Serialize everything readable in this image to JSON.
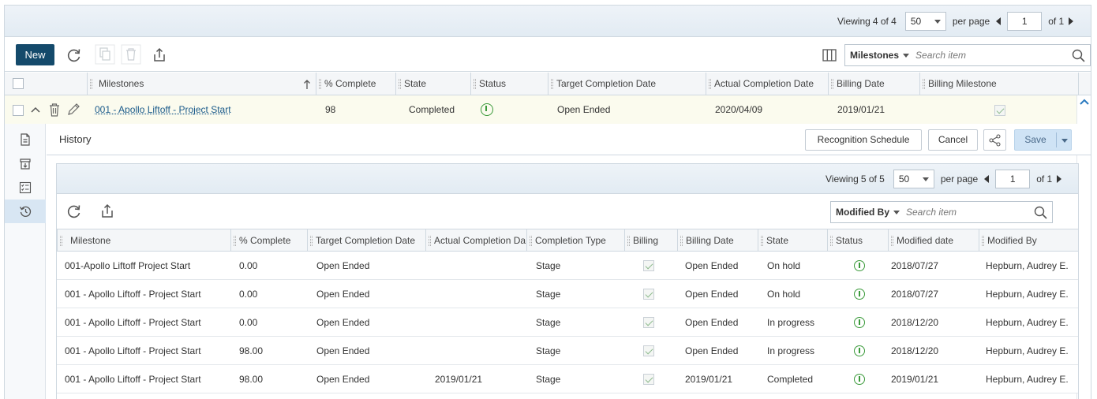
{
  "top_pager": {
    "viewing_label": "Viewing",
    "viewing_range": "4 of 4",
    "per_page_value": "50",
    "per_page_label": "per page",
    "page_value": "1",
    "of_label": "of 1"
  },
  "toolbar": {
    "new_label": "New",
    "search_field": "Milestones",
    "search_placeholder": "Search item"
  },
  "grid": {
    "columns": [
      "Milestones",
      "% Complete",
      "State",
      "Status",
      "Target Completion Date",
      "Actual Completion Date",
      "Billing Date",
      "Billing Milestone"
    ],
    "sorted_column_index": 0,
    "rows": [
      {
        "milestone": "001 - Apollo Liftoff - Project Start",
        "percent_complete": "98",
        "state": "Completed",
        "status": "info",
        "target_completion": "Open Ended",
        "actual_completion": "2020/04/09",
        "billing_date": "2019/01/21",
        "billing_milestone": true
      }
    ]
  },
  "detail": {
    "title": "History",
    "recognition_label": "Recognition Schedule",
    "cancel_label": "Cancel",
    "save_label": "Save",
    "side_nav": [
      "document-icon",
      "archive-icon",
      "checklist-icon",
      "history-icon"
    ],
    "active_side_nav": "history-icon"
  },
  "history_pager": {
    "viewing_label": "Viewing",
    "viewing_range": "5 of 5",
    "per_page_value": "50",
    "per_page_label": "per page",
    "page_value": "1",
    "of_label": "of 1"
  },
  "history_search": {
    "field": "Modified By",
    "placeholder": "Search item"
  },
  "history": {
    "columns": [
      "Milestone",
      "% Complete",
      "Target Completion Date",
      "Actual Completion Da",
      "Completion Type",
      "Billing",
      "Billing Date",
      "State",
      "Status",
      "Modified date",
      "Modified By"
    ],
    "rows": [
      {
        "milestone": "001-Apollo Liftoff Project Start",
        "percent_complete": "0.00",
        "target_completion": "Open Ended",
        "actual_completion": "",
        "completion_type": "Stage",
        "billing": true,
        "billing_date": "Open Ended",
        "state": "On hold",
        "status": "info",
        "modified_date": "2018/07/27",
        "modified_by": "Hepburn, Audrey E."
      },
      {
        "milestone": "001 - Apollo Liftoff - Project Start",
        "percent_complete": "0.00",
        "target_completion": "Open Ended",
        "actual_completion": "",
        "completion_type": "Stage",
        "billing": true,
        "billing_date": "Open Ended",
        "state": "On hold",
        "status": "info",
        "modified_date": "2018/07/27",
        "modified_by": "Hepburn, Audrey E."
      },
      {
        "milestone": "001 - Apollo Liftoff - Project Start",
        "percent_complete": "0.00",
        "target_completion": "Open Ended",
        "actual_completion": "",
        "completion_type": "Stage",
        "billing": true,
        "billing_date": "Open Ended",
        "state": "In progress",
        "status": "info",
        "modified_date": "2018/12/20",
        "modified_by": "Hepburn, Audrey E."
      },
      {
        "milestone": "001 - Apollo Liftoff - Project Start",
        "percent_complete": "98.00",
        "target_completion": "Open Ended",
        "actual_completion": "",
        "completion_type": "Stage",
        "billing": true,
        "billing_date": "Open Ended",
        "state": "In progress",
        "status": "info",
        "modified_date": "2018/12/20",
        "modified_by": "Hepburn, Audrey E."
      },
      {
        "milestone": "001 - Apollo Liftoff - Project Start",
        "percent_complete": "98.00",
        "target_completion": "Open Ended",
        "actual_completion": "2019/01/21",
        "completion_type": "Stage",
        "billing": true,
        "billing_date": "2019/01/21",
        "state": "Completed",
        "status": "info",
        "modified_date": "2019/01/21",
        "modified_by": "Hepburn, Audrey E."
      }
    ]
  },
  "colors": {
    "primary": "#144a6b",
    "link": "#1a5a8a",
    "status_ok": "#3a9a3a",
    "selected_row": "#fbfbee",
    "save_button": "#cfe3f5"
  }
}
